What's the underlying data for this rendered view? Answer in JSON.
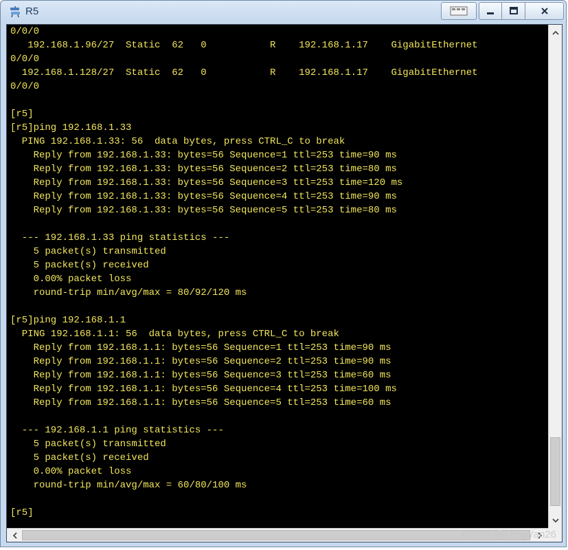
{
  "window": {
    "title": "R5"
  },
  "terminal": {
    "lines": [
      "0/0/0",
      "   192.168.1.96/27  Static  62   0           R    192.168.1.17    GigabitEthernet",
      "0/0/0",
      "  192.168.1.128/27  Static  62   0           R    192.168.1.17    GigabitEthernet",
      "0/0/0",
      "",
      "[r5]",
      "[r5]ping 192.168.1.33",
      "  PING 192.168.1.33: 56  data bytes, press CTRL_C to break",
      "    Reply from 192.168.1.33: bytes=56 Sequence=1 ttl=253 time=90 ms",
      "    Reply from 192.168.1.33: bytes=56 Sequence=2 ttl=253 time=80 ms",
      "    Reply from 192.168.1.33: bytes=56 Sequence=3 ttl=253 time=120 ms",
      "    Reply from 192.168.1.33: bytes=56 Sequence=4 ttl=253 time=90 ms",
      "    Reply from 192.168.1.33: bytes=56 Sequence=5 ttl=253 time=80 ms",
      "",
      "  --- 192.168.1.33 ping statistics ---",
      "    5 packet(s) transmitted",
      "    5 packet(s) received",
      "    0.00% packet loss",
      "    round-trip min/avg/max = 80/92/120 ms",
      "",
      "[r5]ping 192.168.1.1",
      "  PING 192.168.1.1: 56  data bytes, press CTRL_C to break",
      "    Reply from 192.168.1.1: bytes=56 Sequence=1 ttl=253 time=90 ms",
      "    Reply from 192.168.1.1: bytes=56 Sequence=2 ttl=253 time=90 ms",
      "    Reply from 192.168.1.1: bytes=56 Sequence=3 ttl=253 time=60 ms",
      "    Reply from 192.168.1.1: bytes=56 Sequence=4 ttl=253 time=100 ms",
      "    Reply from 192.168.1.1: bytes=56 Sequence=5 ttl=253 time=60 ms",
      "",
      "  --- 192.168.1.1 ping statistics ---",
      "    5 packet(s) transmitted",
      "    5 packet(s) received",
      "    0.00% packet loss",
      "    round-trip min/avg/max = 60/80/100 ms",
      "",
      "[r5]"
    ],
    "text_color": "#f2e65c",
    "background_color": "#000000",
    "scroll_position": 1.0
  },
  "watermark": {
    "text": "CSDN @LengYan26"
  },
  "icons": {
    "app": "router-icon",
    "minimize": "minimize-icon",
    "maximize": "maximize-icon",
    "close": "close-icon",
    "extra": "window-layout-icon"
  }
}
